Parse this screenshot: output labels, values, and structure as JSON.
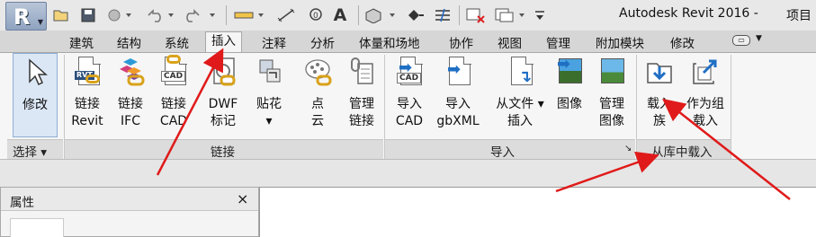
{
  "window": {
    "title": "Autodesk Revit 2016 -",
    "title_suffix": "项目"
  },
  "quick_access": {
    "app_letter": "R",
    "icons": [
      "open-icon",
      "save-icon",
      "sync-icon",
      "undo-icon",
      "redo-icon",
      "measure-icon",
      "dimension-icon",
      "tag-icon",
      "text-icon",
      "3d-view-icon",
      "section-icon",
      "thin-lines-icon",
      "close-views-icon",
      "switch-windows-icon",
      "customize-icon"
    ],
    "text_glyph": "A"
  },
  "tabs": [
    {
      "label": "建筑",
      "active": false
    },
    {
      "label": "结构",
      "active": false
    },
    {
      "label": "系统",
      "active": false
    },
    {
      "label": "插入",
      "active": true
    },
    {
      "label": "注释",
      "active": false
    },
    {
      "label": "分析",
      "active": false
    },
    {
      "label": "体量和场地",
      "active": false
    },
    {
      "label": "协作",
      "active": false
    },
    {
      "label": "视图",
      "active": false
    },
    {
      "label": "管理",
      "active": false
    },
    {
      "label": "附加模块",
      "active": false
    },
    {
      "label": "修改",
      "active": false
    }
  ],
  "ribbon": {
    "select": {
      "modify_label": "修改",
      "panel_title": "选择 ▾"
    },
    "link_panel": {
      "title": "链接",
      "buttons": [
        {
          "line1": "链接",
          "line2": "Revit",
          "icon": "link-revit-icon",
          "tag": "RVT"
        },
        {
          "line1": "链接",
          "line2": "IFC",
          "icon": "link-ifc-icon"
        },
        {
          "line1": "链接",
          "line2": "CAD",
          "icon": "link-cad-icon",
          "tag": "CAD"
        },
        {
          "line1": "DWF",
          "line2": "标记",
          "icon": "dwf-markup-icon"
        },
        {
          "line1": "贴花",
          "line2": "▾",
          "icon": "decal-icon"
        },
        {
          "line1": "点",
          "line2": "云",
          "icon": "point-cloud-icon"
        },
        {
          "line1": "管理",
          "line2": "链接",
          "icon": "manage-links-icon"
        }
      ]
    },
    "import_panel": {
      "title": "导入",
      "buttons": [
        {
          "line1": "导入",
          "line2": "CAD",
          "icon": "import-cad-icon",
          "tag": "CAD"
        },
        {
          "line1": "导入",
          "line2": "gbXML",
          "icon": "import-gbxml-icon"
        },
        {
          "line1": "从文件 ▾",
          "line2": "插入",
          "icon": "insert-from-file-icon"
        },
        {
          "line1": "图像",
          "line2": "",
          "icon": "image-icon"
        },
        {
          "line1": "管理",
          "line2": "图像",
          "icon": "manage-images-icon"
        }
      ],
      "launcher": "↘"
    },
    "load_panel": {
      "title": "从库中载入",
      "buttons": [
        {
          "line1": "载入",
          "line2": "族",
          "icon": "load-family-icon"
        },
        {
          "line1": "作为组",
          "line2": "载入",
          "icon": "load-as-group-icon"
        }
      ]
    }
  },
  "properties": {
    "title": "属性",
    "close": "×"
  },
  "colors": {
    "annotation_arrow": "#e01a1a",
    "ribbon_bg": "#f6f6f6",
    "tab_bar_bg": "#d6d6d6"
  }
}
